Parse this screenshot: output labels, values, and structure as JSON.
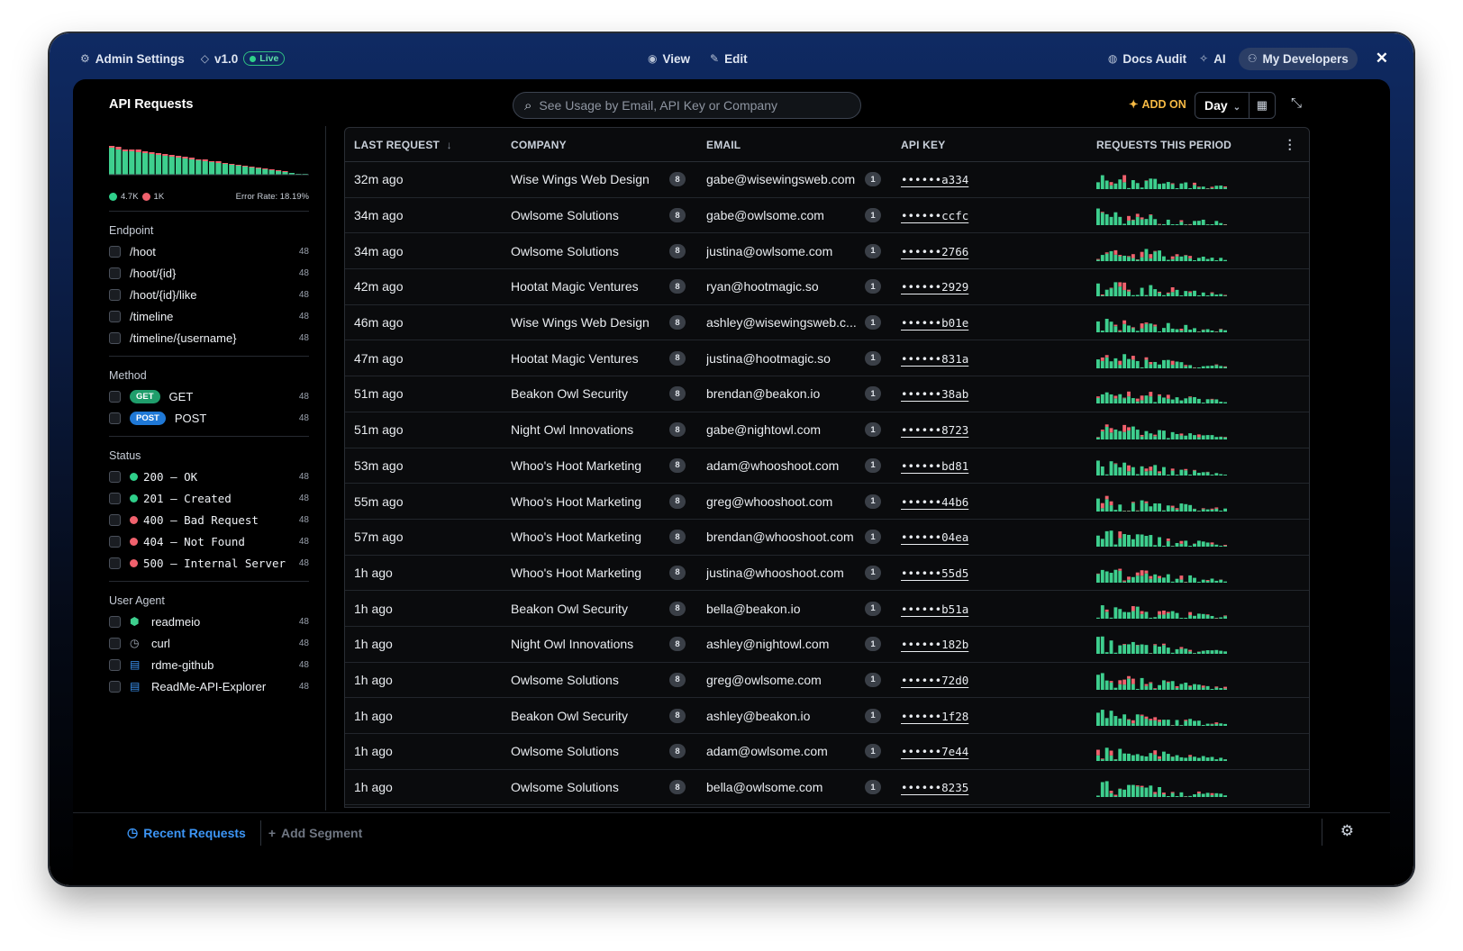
{
  "topbar": {
    "admin_settings": "Admin Settings",
    "version": "v1.0",
    "live": "Live",
    "view": "View",
    "edit": "Edit",
    "docs_audit": "Docs Audit",
    "ai": "AI",
    "my_developers": "My Developers",
    "close": "✕"
  },
  "header": {
    "title": "API Requests",
    "search_placeholder": "See Usage by Email, API Key or Company",
    "add_on": "ADD ON",
    "period": "Day"
  },
  "sidebar": {
    "summary_chart": {
      "success": [
        30,
        28,
        26,
        26,
        25,
        24,
        23,
        22,
        21,
        20,
        19,
        18,
        17,
        16,
        15,
        14,
        13,
        12,
        11,
        10,
        9,
        8,
        7,
        6,
        5,
        4,
        3,
        2,
        1,
        1
      ],
      "errors": [
        2,
        3,
        2,
        2,
        3,
        2,
        2,
        2,
        2,
        2,
        2,
        2,
        2,
        1,
        2,
        1,
        2,
        1,
        1,
        1,
        1,
        1,
        1,
        1,
        1,
        1,
        1,
        0,
        0,
        0
      ],
      "success_color": "#3ecf8e",
      "error_color": "#f0616d"
    },
    "success_count": "4.7K",
    "error_count": "1K",
    "error_rate": "Error Rate: 18.19%",
    "endpoint_label": "Endpoint",
    "endpoints": [
      {
        "label": "/hoot",
        "count": "48"
      },
      {
        "label": "/hoot/{id}",
        "count": "48"
      },
      {
        "label": "/hoot/{id}/like",
        "count": "48"
      },
      {
        "label": "/timeline",
        "count": "48"
      },
      {
        "label": "/timeline/{username}",
        "count": "48"
      }
    ],
    "method_label": "Method",
    "methods": [
      {
        "pill": "GET",
        "label": "GET",
        "count": "48",
        "color": "#1f9d6b"
      },
      {
        "pill": "POST",
        "label": "POST",
        "count": "48",
        "color": "#1f78d6"
      }
    ],
    "status_label": "Status",
    "statuses": [
      {
        "label": "200 – OK",
        "count": "48",
        "color": "#2fcf8a"
      },
      {
        "label": "201 – Created",
        "count": "48",
        "color": "#2fcf8a"
      },
      {
        "label": "400 – Bad Request",
        "count": "48",
        "color": "#f0616d"
      },
      {
        "label": "404 – Not Found",
        "count": "48",
        "color": "#f0616d"
      },
      {
        "label": "500 – Internal Server",
        "count": "48",
        "color": "#f0616d"
      }
    ],
    "agent_label": "User Agent",
    "agents": [
      {
        "icon": "readmeio-icon",
        "glyph": "⬢",
        "label": "readmeio",
        "count": "48",
        "color": "#3ecf8e"
      },
      {
        "icon": "curl-icon",
        "glyph": "◷",
        "label": "curl",
        "count": "48",
        "color": "#aab2bf"
      },
      {
        "icon": "book-icon",
        "glyph": "▤",
        "label": "rdme-github",
        "count": "48",
        "color": "#3c95f5"
      },
      {
        "icon": "book-icon",
        "glyph": "▤",
        "label": "ReadMe-API-Explorer",
        "count": "48",
        "color": "#3c95f5"
      }
    ]
  },
  "table": {
    "columns": [
      "LAST REQUEST",
      "COMPANY",
      "EMAIL",
      "API KEY",
      "REQUESTS THIS PERIOD"
    ],
    "sort_indicator": "↓",
    "rows": [
      {
        "last": "32m ago",
        "company": "Wise Wings Web Design",
        "company_count": "8",
        "email": "gabe@wisewingsweb.com",
        "email_count": "1",
        "key": "••••••a334"
      },
      {
        "last": "34m ago",
        "company": "Owlsome Solutions",
        "company_count": "8",
        "email": "gabe@owlsome.com",
        "email_count": "1",
        "key": "••••••ccfc"
      },
      {
        "last": "34m ago",
        "company": "Owlsome Solutions",
        "company_count": "8",
        "email": "justina@owlsome.com",
        "email_count": "1",
        "key": "••••••2766"
      },
      {
        "last": "42m ago",
        "company": "Hootat Magic Ventures",
        "company_count": "8",
        "email": "ryan@hootmagic.so",
        "email_count": "1",
        "key": "••••••2929"
      },
      {
        "last": "46m ago",
        "company": "Wise Wings Web Design",
        "company_count": "8",
        "email": "ashley@wisewingsweb.c...",
        "email_count": "1",
        "key": "••••••b01e"
      },
      {
        "last": "47m ago",
        "company": "Hootat Magic Ventures",
        "company_count": "8",
        "email": "justina@hootmagic.so",
        "email_count": "1",
        "key": "••••••831a"
      },
      {
        "last": "51m ago",
        "company": "Beakon Owl Security",
        "company_count": "8",
        "email": "brendan@beakon.io",
        "email_count": "1",
        "key": "••••••38ab"
      },
      {
        "last": "51m ago",
        "company": "Night Owl Innovations",
        "company_count": "8",
        "email": "gabe@nightowl.com",
        "email_count": "1",
        "key": "••••••8723"
      },
      {
        "last": "53m ago",
        "company": "Whoo's Hoot Marketing",
        "company_count": "8",
        "email": "adam@whooshoot.com",
        "email_count": "1",
        "key": "••••••bd81"
      },
      {
        "last": "55m ago",
        "company": "Whoo's Hoot Marketing",
        "company_count": "8",
        "email": "greg@whooshoot.com",
        "email_count": "1",
        "key": "••••••44b6"
      },
      {
        "last": "57m ago",
        "company": "Whoo's Hoot Marketing",
        "company_count": "8",
        "email": "brendan@whooshoot.com",
        "email_count": "1",
        "key": "••••••04ea"
      },
      {
        "last": "1h ago",
        "company": "Whoo's Hoot Marketing",
        "company_count": "8",
        "email": "justina@whooshoot.com",
        "email_count": "1",
        "key": "••••••55d5"
      },
      {
        "last": "1h ago",
        "company": "Beakon Owl Security",
        "company_count": "8",
        "email": "bella@beakon.io",
        "email_count": "1",
        "key": "••••••b51a"
      },
      {
        "last": "1h ago",
        "company": "Night Owl Innovations",
        "company_count": "8",
        "email": "ashley@nightowl.com",
        "email_count": "1",
        "key": "••••••182b"
      },
      {
        "last": "1h ago",
        "company": "Owlsome Solutions",
        "company_count": "8",
        "email": "greg@owlsome.com",
        "email_count": "1",
        "key": "••••••72d0"
      },
      {
        "last": "1h ago",
        "company": "Beakon Owl Security",
        "company_count": "8",
        "email": "ashley@beakon.io",
        "email_count": "1",
        "key": "••••••1f28"
      },
      {
        "last": "1h ago",
        "company": "Owlsome Solutions",
        "company_count": "8",
        "email": "adam@owlsome.com",
        "email_count": "1",
        "key": "••••••7e44"
      },
      {
        "last": "1h ago",
        "company": "Owlsome Solutions",
        "company_count": "8",
        "email": "bella@owlsome.com",
        "email_count": "1",
        "key": "••••••8235"
      }
    ]
  },
  "footer": {
    "recent_requests": "Recent Requests",
    "add_segment": "Add Segment"
  }
}
